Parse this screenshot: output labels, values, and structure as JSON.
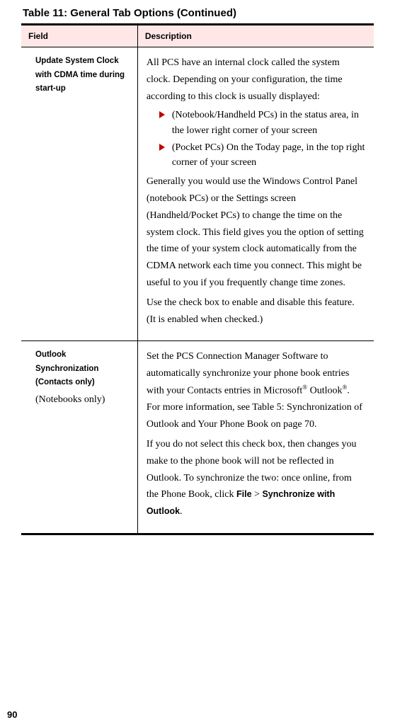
{
  "title": "Table 11: General Tab Options (Continued)",
  "headers": {
    "field": "Field",
    "desc": "Description"
  },
  "row1": {
    "field": "Update System Clock with CDMA time during start-up",
    "p1": "All PCS have an internal clock called the system clock. Depending on your configuration, the time according to this clock is usually displayed:",
    "b1": "(Notebook/Handheld PCs) in the status area, in the lower right corner of your screen",
    "b2": "(Pocket PCs) On the Today page, in the top right corner of your screen",
    "p2": "Generally you would use the Windows Control Panel (notebook PCs) or the Settings screen (Handheld/Pocket PCs) to change the time on the system clock. This field gives you the option of setting the time of your system clock automatically from the CDMA network each time you connect. This might be useful to you if you frequently change time zones.",
    "p3": "Use the check box to enable and disable this feature. (It is enabled when checked.)"
  },
  "row2": {
    "field": "Outlook Synchronization (Contacts only)",
    "note": "(Notebooks only)",
    "p1a": "Set the PCS Connection Manager Software to automatically synchronize your phone book entries with your Contacts entries in Microsoft",
    "reg": "®",
    "p1b": " Outlook",
    "p1c": ". For more information, see Table 5: Synchronization of Outlook and Your Phone Book on page 70.",
    "p2a": "If you do not select this check box, then changes you make to the phone book will not be reflected in Outlook. To synchronize the two: once online, from the Phone Book, click ",
    "ui_file": "File",
    "gt": " > ",
    "ui_sync": "Synchronize with Outlook",
    "dot": "."
  },
  "pageNumber": "90"
}
